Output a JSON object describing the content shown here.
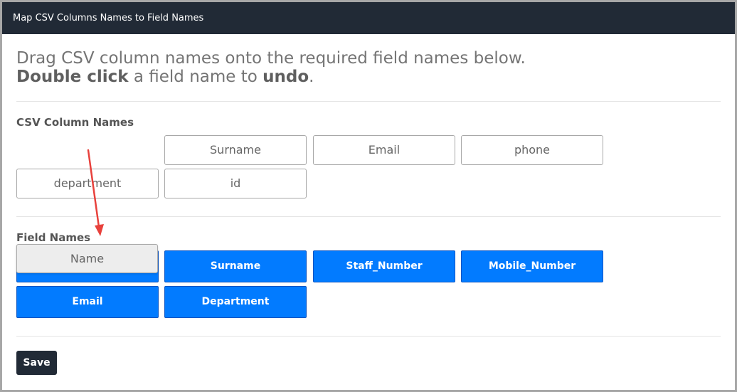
{
  "window": {
    "title": "Map CSV Columns Names to Field Names"
  },
  "instructions": {
    "line1": "Drag CSV column names onto the required field names below.",
    "line2_bold1": "Double click",
    "line2_mid": " a field name to ",
    "line2_bold2": "undo",
    "line2_end": "."
  },
  "csv_columns": {
    "heading": "CSV Column Names",
    "items": [
      "Surname",
      "Email",
      "phone",
      "department",
      "id"
    ]
  },
  "field_names": {
    "heading": "Field Names",
    "items": [
      "Surname",
      "Staff_Number",
      "Mobile_Number",
      "Email",
      "Department"
    ]
  },
  "dragged_item": {
    "label": "Name"
  },
  "actions": {
    "save_label": "Save"
  },
  "colors": {
    "titlebar": "#212a36",
    "field_blue": "#027bff",
    "arrow_red": "#e8413c"
  }
}
